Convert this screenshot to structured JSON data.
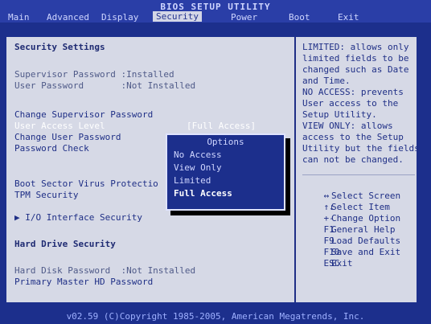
{
  "bios": {
    "title": "BIOS SETUP UTILITY",
    "menu": [
      "Main",
      "Advanced",
      "Display",
      "Security",
      "Power",
      "Boot",
      "Exit"
    ],
    "active_menu": "Security"
  },
  "left_panel": {
    "section_title": "Security Settings",
    "supervisor_password": "Supervisor Password :Installed",
    "user_password": "User Password       :Not Installed",
    "change_supervisor_password": "Change Supervisor Password",
    "user_access_level_label": "User Access Level",
    "user_access_level_value": "[Full Access]",
    "change_user_password": "Change User Password",
    "password_check": "Password Check",
    "boot_sector_virus_protection": "Boot Sector Virus Protectio",
    "tpm_security": "TPM Security",
    "io_interface_security": "▶ I/O Interface Security",
    "hard_drive_security": "Hard Drive Security",
    "hard_disk_password": "Hard Disk Password  :Not Installed",
    "primary_master_hd_password": "Primary Master HD Password"
  },
  "options_popup": {
    "title": "Options",
    "items": [
      "No Access",
      "View Only",
      "Limited",
      "Full Access"
    ],
    "selected": "Full Access"
  },
  "help_panel": {
    "text_lines": [
      "LIMITED: allows only",
      "limited fields to be",
      "changed such as Date",
      "and Time.",
      "NO ACCESS: prevents",
      "User access to the",
      "Setup Utility.",
      "VIEW ONLY: allows",
      "access to the Setup",
      "Utility but the fields",
      "can not be changed."
    ],
    "key_help": [
      {
        "key": "↔",
        "desc": "Select Screen"
      },
      {
        "key": "↑↓",
        "desc": "Select Item"
      },
      {
        "key": "+-",
        "desc": "Change Option"
      },
      {
        "key": "F1",
        "desc": "General Help"
      },
      {
        "key": "F9",
        "desc": "Load Defaults"
      },
      {
        "key": "F10",
        "desc": "Save and Exit"
      },
      {
        "key": "ESC",
        "desc": "Exit"
      }
    ]
  },
  "footer": {
    "copyright": "v02.59 (C)Copyright 1985-2005, American Megatrends, Inc."
  },
  "colors": {
    "background": "#1c2f8c",
    "panel": "#d6d9e6",
    "text": "#1f2f86",
    "highlight": "#ffffff"
  }
}
